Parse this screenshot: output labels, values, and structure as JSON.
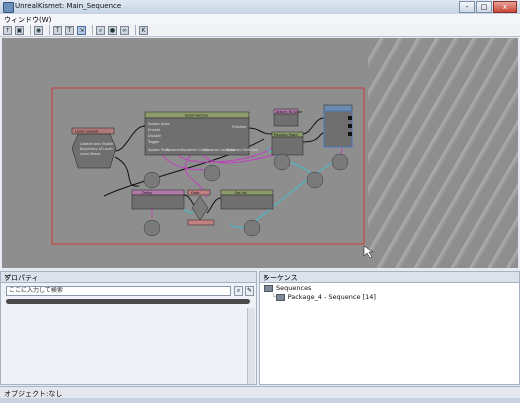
{
  "window": {
    "title": "UnrealKismet: Main_Sequence",
    "controls": [
      "-",
      "□",
      "x"
    ]
  },
  "menu": {
    "window_label": "ウィンドウ(W)"
  },
  "toolbar": {
    "icons": [
      "open-parent-icon",
      "rebuild-icon",
      "eye-icon",
      "filter-icon",
      "filter2-icon",
      "zoom-fit-icon",
      "search-icon",
      "magnify-icon",
      "link-icon",
      "kismet-icon"
    ]
  },
  "canvas": {
    "selection_color": "#d2393b",
    "background_color": "#8e8e8e",
    "nodes": {
      "level_loaded": "Level Loaded",
      "level_loaded_out1": "Loaded and Visible",
      "level_loaded_out2": "Beginning of Level",
      "level_loaded_out3": "Level Reset",
      "actor_factory": "Actor Factory",
      "actor_factory_in1": "Spawn Actor",
      "actor_factory_in2": "Enable",
      "actor_factory_in3": "Disable",
      "actor_factory_in4": "Toggle",
      "actor_factory_out": "Finished",
      "actor_factory_link1": "Spawn Point",
      "actor_factory_link2": "Spawned",
      "actor_factory_link3": "Spawner Count",
      "actor_factory_link4": "Spawner Location",
      "actor_factory_link5": "Spawner Direction",
      "attach": "Attach To Actor",
      "possess": "Possess Pawn",
      "delay": "Delay",
      "gate": "Gate",
      "set_int": "Set Int",
      "all_players": "All Players",
      "player": "Player 0"
    }
  },
  "properties_panel": {
    "title": "プロパティ",
    "search_placeholder": "ここに入力して検索"
  },
  "sequences_panel": {
    "title": "シーケンス",
    "root": "Sequences",
    "child": "Package_4 - Sequence [14]"
  },
  "status": {
    "object_label": "オブジェクト:なし"
  }
}
